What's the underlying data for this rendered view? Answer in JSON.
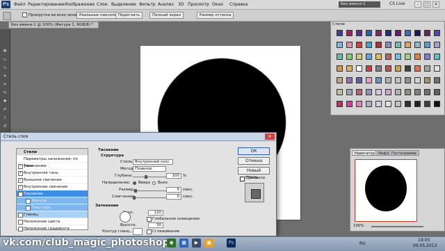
{
  "app": {
    "logo": "Ps"
  },
  "menu": [
    "Файл",
    "Редактирование",
    "Изображение",
    "Слои",
    "Выделение",
    "Фильтр",
    "Анализ",
    "3D",
    "Просмотр",
    "Окно",
    "Справка"
  ],
  "doc_switcher": "Без имени-1",
  "cs_live": "CS Live",
  "window_buttons": [
    "–",
    "□",
    "✕"
  ],
  "options_bar": {
    "scroll_all_windows_label": "Прокрутка во всех окнах",
    "buttons": [
      "Реальные пикселы",
      "Подогнать",
      "Полный экран",
      "Размер оттиска"
    ]
  },
  "document_tab": "Без имени-1 @ 100% (Фигура 1, RGB/8) *",
  "styles_panel": {
    "title": "Стили",
    "swatch_colors": [
      "#3b3b8f",
      "#a0205a",
      "#5a2a8a",
      "#2a5fa8",
      "#7a2a6a",
      "#2a2a7a",
      "#6a1a6a",
      "#3a6ab0",
      "#1a1a5a",
      "#5a2a5a",
      "#4a4aa8",
      "#7ab8e0",
      "#e08ab0",
      "#d04040",
      "#4a9ed8",
      "#b03030",
      "#8a8ac0",
      "#6ac0a8",
      "#e0a060",
      "#8ab8c8",
      "#5a9ad0",
      "#a0a0d0",
      "#60c0a0",
      "#80d070",
      "#d0d060",
      "#60a8e0",
      "#e0c040",
      "#c06060",
      "#70c0e0",
      "#a0d080",
      "#e08040",
      "#8080d0",
      "#60c0c0",
      "#e09040",
      "#e0b060",
      "#ffffff",
      "#d04040",
      "#808080",
      "#c05050",
      "#d0a040",
      "#404040",
      "#e07050",
      "#a0a0a0",
      "#e0e0e0",
      "#c0a080",
      "#9070b0",
      "#6060a0",
      "#e0a0c0",
      "#7090c0",
      "#b0b0b0",
      "#c0c0c0",
      "#909090",
      "#d0d0d0",
      "#a09070",
      "#707070",
      "#c0c0a0",
      "#a0a0b0",
      "#c06070",
      "#9090c0",
      "#e0c0e0",
      "#d0a0d0",
      "#b0b0b0",
      "#909080",
      "#808080",
      "#707070",
      "#606060",
      "#c03060",
      "#d040a0",
      "#e080c0",
      "#b0b0c0",
      "#d0d0e0",
      "#e0e0e0",
      "#c0c0c0",
      "#303030",
      "#202020",
      "#404040",
      "#101010"
    ]
  },
  "navigator": {
    "tabs": [
      "Навигатор",
      "Инфо",
      "Гистограмма"
    ],
    "zoom": "100%"
  },
  "dialog": {
    "title": "Стиль слоя",
    "close_label": "✕",
    "list_header": "Стили",
    "list_items": [
      {
        "label": "Параметры наложения: по умолчанию",
        "checkbox": false,
        "checked": false
      },
      {
        "label": "Тень",
        "checkbox": true,
        "checked": true
      },
      {
        "label": "Внутренняя тень",
        "checkbox": true,
        "checked": true
      },
      {
        "label": "Внешнее свечение",
        "checkbox": true,
        "checked": true
      },
      {
        "label": "Внутреннее свечение",
        "checkbox": true,
        "checked": true
      },
      {
        "label": "Тиснение",
        "checkbox": true,
        "checked": true
      },
      {
        "label": "Контур",
        "checkbox": true,
        "checked": false
      },
      {
        "label": "Текстура",
        "checkbox": true,
        "checked": false
      },
      {
        "label": "Глянец",
        "checkbox": true,
        "checked": false
      },
      {
        "label": "Наложение цвета",
        "checkbox": true,
        "checked": false
      },
      {
        "label": "Наложение градиента",
        "checkbox": true,
        "checked": false
      }
    ],
    "section_title": "Тиснение",
    "structure": {
      "title": "Структура",
      "style_label": "Стиль:",
      "style_value": "Внутренний скос",
      "method_label": "Метод:",
      "method_value": "Плавное",
      "depth_label": "Глубина:",
      "depth_value": "100",
      "depth_unit": "%",
      "direction_label": "Направление:",
      "direction_up": "Вверх",
      "direction_down": "Вниз",
      "size_label": "Размер:",
      "size_value": "5",
      "size_unit": "пикс.",
      "soften_label": "Смягчение:",
      "soften_value": "0",
      "soften_unit": "пикс."
    },
    "shading": {
      "title": "Затенение",
      "angle_label": "Угол:",
      "angle_value": "120",
      "global_light_label": "Глобальное освещение",
      "altitude_label": "Высота:",
      "altitude_value": "30",
      "gloss_label": "Контур глянц...:",
      "antialias_label": "Сглаживание"
    },
    "buttons": {
      "ok": "ОК",
      "cancel": "Отмена",
      "new_style": "Новый стиль...",
      "preview": "Просмотр"
    }
  },
  "taskbar": {
    "watermark": "vk.com/club_magic_photoshop",
    "lang": "RU",
    "time": "19:00",
    "date": "09.05.2013"
  }
}
